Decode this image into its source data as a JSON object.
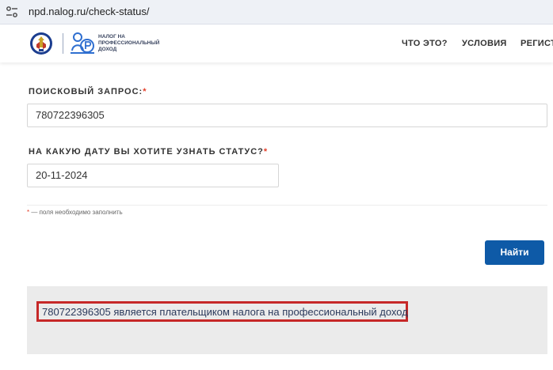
{
  "browser": {
    "url": "npd.nalog.ru/check-status/"
  },
  "header": {
    "logo_line1": "НАЛОГ НА",
    "logo_line2": "ПРОФЕССИОНАЛЬНЫЙ",
    "logo_line3": "ДОХОД",
    "nav": [
      "ЧТО ЭТО?",
      "УСЛОВИЯ",
      "РЕГИСТ"
    ]
  },
  "form": {
    "query_label": "ПОИСКОВЫЙ ЗАПРОС:",
    "query_value": "780722396305",
    "date_label": "НА КАКУЮ ДАТУ ВЫ ХОТИТЕ УЗНАТЬ СТАТУС?",
    "date_value": "20-11-2024",
    "required_mark": "*",
    "required_note": "— поля необходимо заполнить",
    "search_button": "Найти"
  },
  "result": {
    "text": "780722396305 является плательщиком налога на профессиональный доход",
    "highlight_color": "#c62828"
  },
  "colors": {
    "primary_button": "#0e5aa7",
    "required": "#e4402b"
  }
}
